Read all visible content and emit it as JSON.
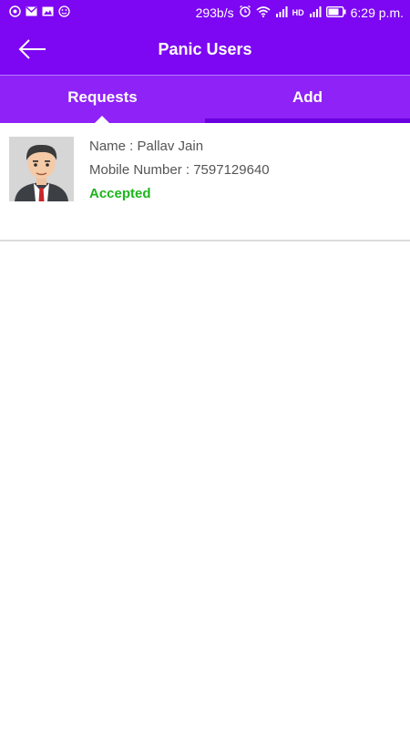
{
  "status_bar": {
    "speed": "293b/s",
    "network_badge": "HD",
    "time": "6:29 p.m."
  },
  "app_bar": {
    "title": "Panic Users"
  },
  "tabs": [
    {
      "label": "Requests",
      "active": true
    },
    {
      "label": "Add",
      "active": false
    }
  ],
  "list": {
    "items": [
      {
        "name": "Name : Pallav Jain",
        "mobile": "Mobile Number : 7597129640",
        "status": "Accepted"
      }
    ]
  },
  "colors": {
    "primary": "#7d07f2",
    "tab_bar": "#8f22f6",
    "accepted": "#1db51d"
  }
}
